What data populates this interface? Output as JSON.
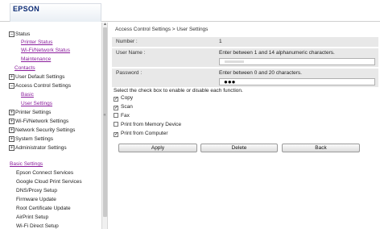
{
  "header": {
    "logo_text": "EPSON"
  },
  "sidebar": {
    "groups": [
      {
        "toggle": "−",
        "label": "Status"
      },
      {
        "toggle": "+",
        "label": "User Default Settings"
      },
      {
        "toggle": "−",
        "label": "Access Control Settings"
      },
      {
        "toggle": "+",
        "label": "Printer Settings"
      },
      {
        "toggle": "+",
        "label": "Wi-Fi/Network Settings"
      },
      {
        "toggle": "+",
        "label": "Network Security Settings"
      },
      {
        "toggle": "+",
        "label": "System Settings"
      },
      {
        "toggle": "+",
        "label": "Administrator Settings"
      }
    ],
    "status_links": [
      "Printer Status",
      "Wi-Fi/Network Status",
      "Maintenance"
    ],
    "contacts_link": "Contacts",
    "access_links": [
      "Basic",
      "User Settings"
    ],
    "basic_heading": "Basic Settings",
    "basic_items": [
      "Epson Connect Services",
      "Google Cloud Print Services",
      "DNS/Proxy Setup",
      "Firmware Update",
      "Root Certificate Update",
      "AirPrint Setup",
      "Wi-Fi Direct Setup"
    ],
    "splitter_glyph": "«",
    "scroll_up_glyph": "▲"
  },
  "content": {
    "breadcrumb": "Access Control Settings > User Settings",
    "number": {
      "label": "Number :",
      "value": "1"
    },
    "username": {
      "label": "User Name :",
      "hint": "Enter between 1 and 14 alphanumeric characters."
    },
    "password": {
      "label": "Password :",
      "hint": "Enter between 0 and 20 characters.",
      "masked_value": "●●●"
    },
    "instruction": "Select the check box to enable or disable each function.",
    "checkboxes": [
      {
        "label": "Copy",
        "checked": true,
        "mark": "✓"
      },
      {
        "label": "Scan",
        "checked": true,
        "mark": "✓"
      },
      {
        "label": "Fax",
        "checked": false,
        "mark": ""
      },
      {
        "label": "Print from Memory Device",
        "checked": false,
        "mark": ""
      },
      {
        "label": "Print from Computer",
        "checked": true,
        "mark": "✓"
      }
    ],
    "buttons": {
      "apply": "Apply",
      "delete": "Delete",
      "back": "Back"
    }
  }
}
